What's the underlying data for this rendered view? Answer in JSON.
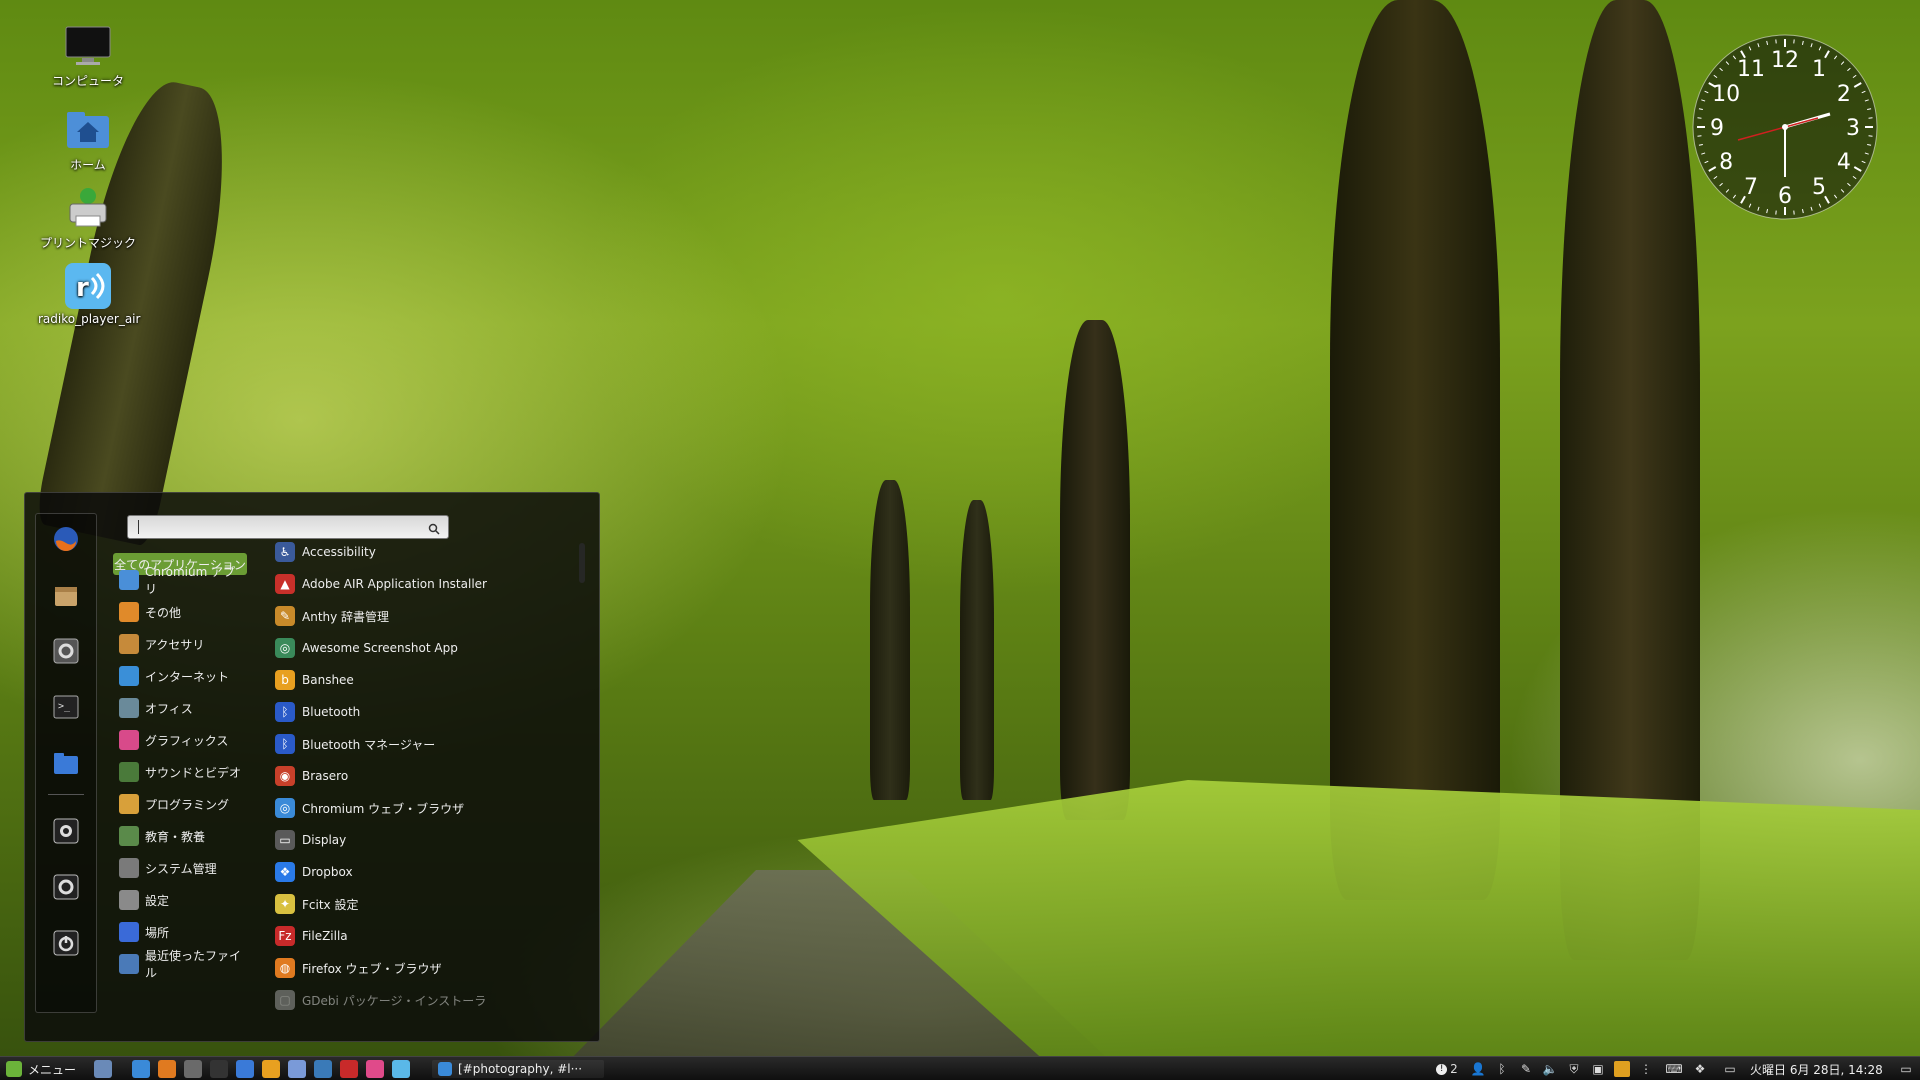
{
  "desktop": {
    "icons": [
      {
        "label": "コンピュータ",
        "icon": "monitor-icon"
      },
      {
        "label": "ホーム",
        "icon": "home-folder-icon"
      },
      {
        "label": "プリントマジック",
        "icon": "printer-icon"
      },
      {
        "label": "radiko_player_air",
        "icon": "radiko-icon"
      }
    ]
  },
  "clock": {
    "numerals": [
      "12",
      "1",
      "2",
      "3",
      "4",
      "5",
      "6",
      "7",
      "8",
      "9",
      "10",
      "11"
    ]
  },
  "menu": {
    "search": {
      "placeholder": ""
    },
    "favorites": [
      {
        "name": "firefox",
        "icon": "firefox-icon"
      },
      {
        "name": "software-manager",
        "icon": "package-icon"
      },
      {
        "name": "system-settings",
        "icon": "settings-icon"
      },
      {
        "name": "terminal",
        "icon": "terminal-icon"
      },
      {
        "name": "files",
        "icon": "folder-icon"
      },
      {
        "name": "lock-screen",
        "icon": "lock-icon"
      },
      {
        "name": "logout",
        "icon": "logout-icon"
      },
      {
        "name": "shutdown",
        "icon": "power-icon"
      }
    ],
    "categories": [
      {
        "label": "全てのアプリケーション",
        "color": "#6b9d34"
      },
      {
        "label": "Chromium アプリ",
        "color": "#4a8fd8"
      },
      {
        "label": "その他",
        "color": "#e08a2a"
      },
      {
        "label": "アクセサリ",
        "color": "#c68a3a"
      },
      {
        "label": "インターネット",
        "color": "#3a8fd8"
      },
      {
        "label": "オフィス",
        "color": "#6a8a9a"
      },
      {
        "label": "グラフィックス",
        "color": "#d84a8a"
      },
      {
        "label": "サウンドとビデオ",
        "color": "#4a7a3a"
      },
      {
        "label": "プログラミング",
        "color": "#d8a03a"
      },
      {
        "label": "教育・教養",
        "color": "#5a8a4a"
      },
      {
        "label": "システム管理",
        "color": "#7a7a7a"
      },
      {
        "label": "設定",
        "color": "#8a8a8a"
      },
      {
        "label": "場所",
        "color": "#3a6ad8"
      },
      {
        "label": "最近使ったファイル",
        "color": "#4a7ab8"
      }
    ],
    "applications": [
      {
        "label": "Accessibility",
        "color": "#3a5a9a",
        "glyph": "♿"
      },
      {
        "label": "Adobe AIR Application Installer",
        "color": "#c8302a",
        "glyph": "▲"
      },
      {
        "label": "Anthy 辞書管理",
        "color": "#c88a2a",
        "glyph": "✎"
      },
      {
        "label": "Awesome Screenshot App",
        "color": "#3a8a5a",
        "glyph": "◎"
      },
      {
        "label": "Banshee",
        "color": "#e8a020",
        "glyph": "b"
      },
      {
        "label": "Bluetooth",
        "color": "#2a5ac8",
        "glyph": "ᛒ"
      },
      {
        "label": "Bluetooth マネージャー",
        "color": "#2a5ac8",
        "glyph": "ᛒ"
      },
      {
        "label": "Brasero",
        "color": "#c8402a",
        "glyph": "◉"
      },
      {
        "label": "Chromium ウェブ・ブラウザ",
        "color": "#3a8ad8",
        "glyph": "◎"
      },
      {
        "label": "Display",
        "color": "#5a5a5a",
        "glyph": "▭"
      },
      {
        "label": "Dropbox",
        "color": "#2a7ae8",
        "glyph": "❖"
      },
      {
        "label": "Fcitx 設定",
        "color": "#d8c040",
        "glyph": "✦"
      },
      {
        "label": "FileZilla",
        "color": "#c82a2a",
        "glyph": "Fz"
      },
      {
        "label": "Firefox ウェブ・ブラウザ",
        "color": "#e07a20",
        "glyph": "◍"
      },
      {
        "label": "GDebi パッケージ・インストーラ",
        "color": "#aaaaaa",
        "glyph": "▢"
      }
    ]
  },
  "taskbar": {
    "menu_label": "メニュー",
    "launchers": [
      "show-desktop-icon",
      "chromium-icon",
      "firefox-icon",
      "system-monitor-icon",
      "terminal-icon",
      "files-icon",
      "banshee-icon",
      "pidgin-icon",
      "thunderbird-icon",
      "filezilla-icon",
      "gimp-icon",
      "shotwell-icon"
    ],
    "window_title": "[#photography, #l···",
    "tray": {
      "notification_count": "2",
      "datetime": "火曜日 6月 28日, 14:28"
    }
  }
}
